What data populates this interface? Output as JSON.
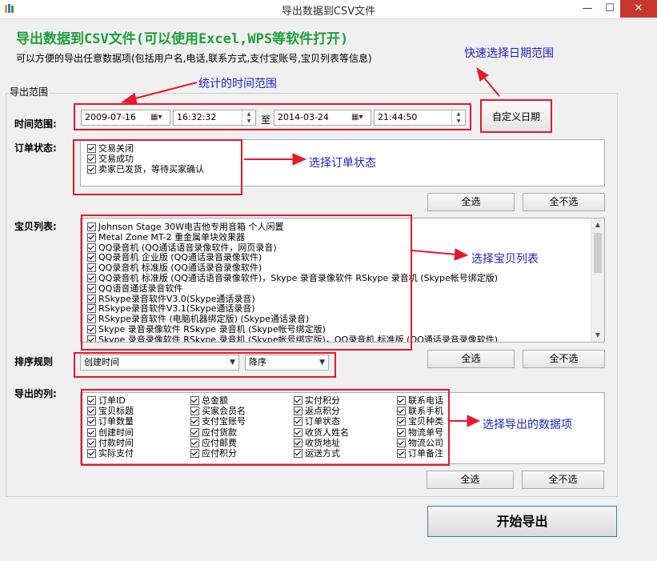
{
  "window": {
    "title": "导出数据到CSV文件",
    "minimize_glyph": "—",
    "maximize_glyph": "☐",
    "close_glyph": "✕"
  },
  "header": {
    "heading": "导出数据到CSV文件(可以使用Excel,WPS等软件打开)",
    "description": "可以方便的导出任意数据项(包括用户名,电话,联系方式,支付宝账号,宝贝列表等信息)"
  },
  "annotations": {
    "quick_date": "快速选择日期范围",
    "time_range": "统计的时间范围",
    "order_status": "选择订单状态",
    "item_list": "选择宝贝列表",
    "columns": "选择导出的数据项"
  },
  "group": {
    "legend": "导出范围"
  },
  "time_range": {
    "label": "时间范围:",
    "start_date": "2009-07-16",
    "start_time": "16:32:32",
    "to_label": "至",
    "end_date": "2014-03-24",
    "end_time": "21:44:50",
    "custom_button": "自定义日期"
  },
  "order_status": {
    "label": "订单状态:",
    "items": [
      "交易关闭",
      "交易成功",
      "卖家已发货，等待买家确认"
    ],
    "select_all": "全选",
    "select_none": "全不选"
  },
  "item_list": {
    "label": "宝贝列表:",
    "items": [
      "Johnson Stage 30W电吉他专用音箱 个人闲置",
      "Metal Zone MT-2 重金属单块效果器",
      "QQ录音机 (QQ通话语音录像软件，网页录音)",
      "QQ录音机 企业版 (QQ通话录音录像软件)",
      "QQ录音机 标准版 (QQ通话录音录像软件)",
      "QQ录音机 标准版 (QQ通话语音录像软件)，Skype 录音录像软件 RSkype 录音机 (Skype帐号绑定版)",
      "QQ语音通话录音软件",
      "RSkype录音软件V3.0(Skype通话录音)",
      "RSkype录音软件V3.1(Skype通话录音)",
      "RSkype录音软件 (电脑机器绑定版) (Skype通话录音)",
      "Skype 录音录像软件 RSkype 录音机 (Skype帐号绑定版)",
      "Skype 录音录像软件 RSkype 录音机 (Skype帐号绑定版)，QQ录音机 标准版 (QQ通话录音录像软件)"
    ],
    "select_all": "全选",
    "select_none": "全不选"
  },
  "sort": {
    "label": "排序规则",
    "field": "创建时间",
    "order": "降序"
  },
  "columns": {
    "label": "导出的列:",
    "col1": [
      "订单ID",
      "宝贝标题",
      "订单数量",
      "创建时间",
      "付款时间",
      "实际支付"
    ],
    "col2": [
      "总金额",
      "买家会员名",
      "支付宝账号",
      "应付货款",
      "应付邮费",
      "应付积分"
    ],
    "col3": [
      "实付积分",
      "返点积分",
      "订单状态",
      "收货人姓名",
      "收货地址",
      "运送方式"
    ],
    "col4": [
      "联系电话",
      "联系手机",
      "宝贝种类",
      "物流单号",
      "物流公司",
      "订单备注"
    ],
    "select_all": "全选",
    "select_none": "全不选"
  },
  "start_button": "开始导出",
  "colors": {
    "heading_green": "#1da03a",
    "annotation_blue": "#1f25c9",
    "highlight_red": "#e8182b"
  }
}
